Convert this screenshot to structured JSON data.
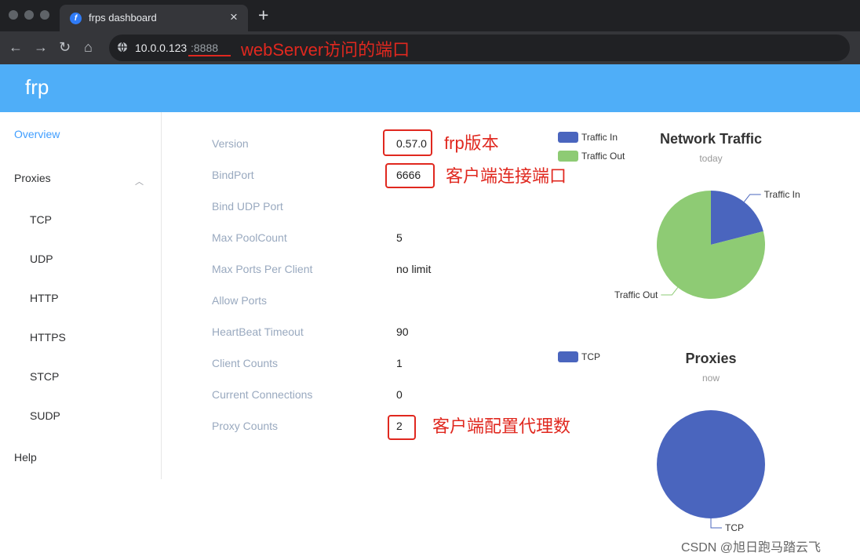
{
  "browser": {
    "tab_title": "frps dashboard",
    "tab_close": "×",
    "new_tab": "+",
    "url_host": "10.0.0.123",
    "url_port": ":8888",
    "nav": {
      "back": "←",
      "forward": "→",
      "reload": "↻",
      "home": "⌂"
    }
  },
  "annotations": {
    "port_note": "webServer访问的端口",
    "version_note": "frp版本",
    "bindport_note": "客户端连接端口",
    "proxy_note": "客户端配置代理数"
  },
  "app": {
    "logo": "frp"
  },
  "sidebar": {
    "overview": "Overview",
    "proxies": "Proxies",
    "chevron": "︿",
    "sub_items": [
      "TCP",
      "UDP",
      "HTTP",
      "HTTPS",
      "STCP",
      "SUDP"
    ],
    "help": "Help"
  },
  "info": [
    {
      "label": "Version",
      "value": "0.57.0"
    },
    {
      "label": "BindPort",
      "value": "6666"
    },
    {
      "label": "Bind UDP Port",
      "value": ""
    },
    {
      "label": "Max PoolCount",
      "value": "5"
    },
    {
      "label": "Max Ports Per Client",
      "value": "no limit"
    },
    {
      "label": "Allow Ports",
      "value": ""
    },
    {
      "label": "HeartBeat Timeout",
      "value": "90"
    },
    {
      "label": "Client Counts",
      "value": "1"
    },
    {
      "label": "Current Connections",
      "value": "0"
    },
    {
      "label": "Proxy Counts",
      "value": "2"
    }
  ],
  "colors": {
    "traffic_in": "#4a65be",
    "traffic_out": "#8ecb74",
    "tcp": "#4a65be",
    "accent": "#409eff",
    "annotation": "#e0281f"
  },
  "chart_data": [
    {
      "type": "pie",
      "title": "Network Traffic",
      "subtitle": "today",
      "legend": [
        "Traffic In",
        "Traffic Out"
      ],
      "labels": [
        "Traffic In",
        "Traffic Out"
      ],
      "values": [
        21,
        79
      ],
      "colors": [
        "#4a65be",
        "#8ecb74"
      ]
    },
    {
      "type": "pie",
      "title": "Proxies",
      "subtitle": "now",
      "legend": [
        "TCP"
      ],
      "labels": [
        "TCP"
      ],
      "values": [
        100
      ],
      "colors": [
        "#4a65be"
      ]
    }
  ],
  "watermark": "CSDN @旭日跑马踏云飞"
}
